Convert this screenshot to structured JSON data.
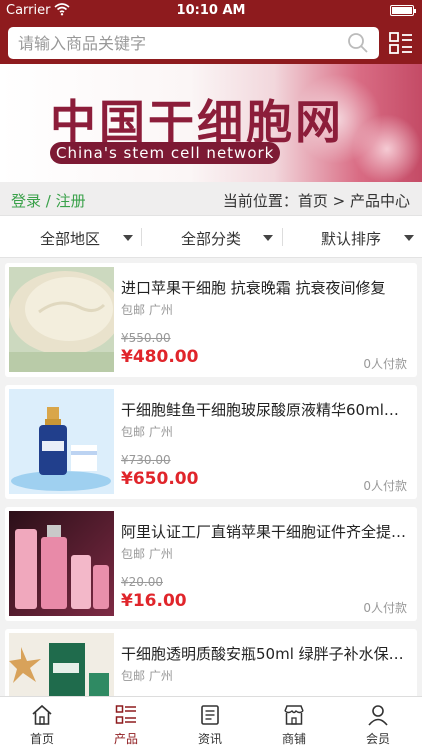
{
  "status_bar": {
    "carrier": "Carrier",
    "time": "10:10 AM"
  },
  "search": {
    "placeholder": "请输入商品关键字"
  },
  "banner": {
    "title_cn": "中国干细胞网",
    "title_en": "China's stem cell network"
  },
  "crumb_bar": {
    "login": "登录 / 注册",
    "location": "当前位置：首页 > 产品中心"
  },
  "filters": [
    {
      "label": "全部地区"
    },
    {
      "label": "全部分类"
    },
    {
      "label": "默认排序"
    }
  ],
  "products": [
    {
      "title": "进口苹果干细胞 抗衰晚霜 抗衰夜间修复",
      "ship": "包邮 广州",
      "old_price": "¥550.00",
      "price": "¥480.00",
      "sold": "0人付款"
    },
    {
      "title": "干细胞鲑鱼干细胞玻尿酸原液精华60ml…",
      "ship": "包邮 广州",
      "old_price": "¥730.00",
      "price": "¥650.00",
      "sold": "0人付款"
    },
    {
      "title": "阿里认证工厂直销苹果干细胞证件齐全提…",
      "ship": "包邮 广州",
      "old_price": "¥20.00",
      "price": "¥16.00",
      "sold": "0人付款"
    },
    {
      "title": "干细胞透明质酸安瓶50ml 绿胖子补水保…",
      "ship": "包邮 广州",
      "old_price": "",
      "price": "",
      "sold": ""
    }
  ],
  "tabbar": [
    {
      "label": "首页",
      "icon": "home-icon"
    },
    {
      "label": "产品",
      "icon": "list-icon",
      "active": true
    },
    {
      "label": "资讯",
      "icon": "news-icon"
    },
    {
      "label": "商铺",
      "icon": "shop-icon"
    },
    {
      "label": "会员",
      "icon": "user-icon"
    }
  ],
  "colors": {
    "brand": "#8e1b1e",
    "price": "#e0252b",
    "login": "#3aa14a"
  }
}
